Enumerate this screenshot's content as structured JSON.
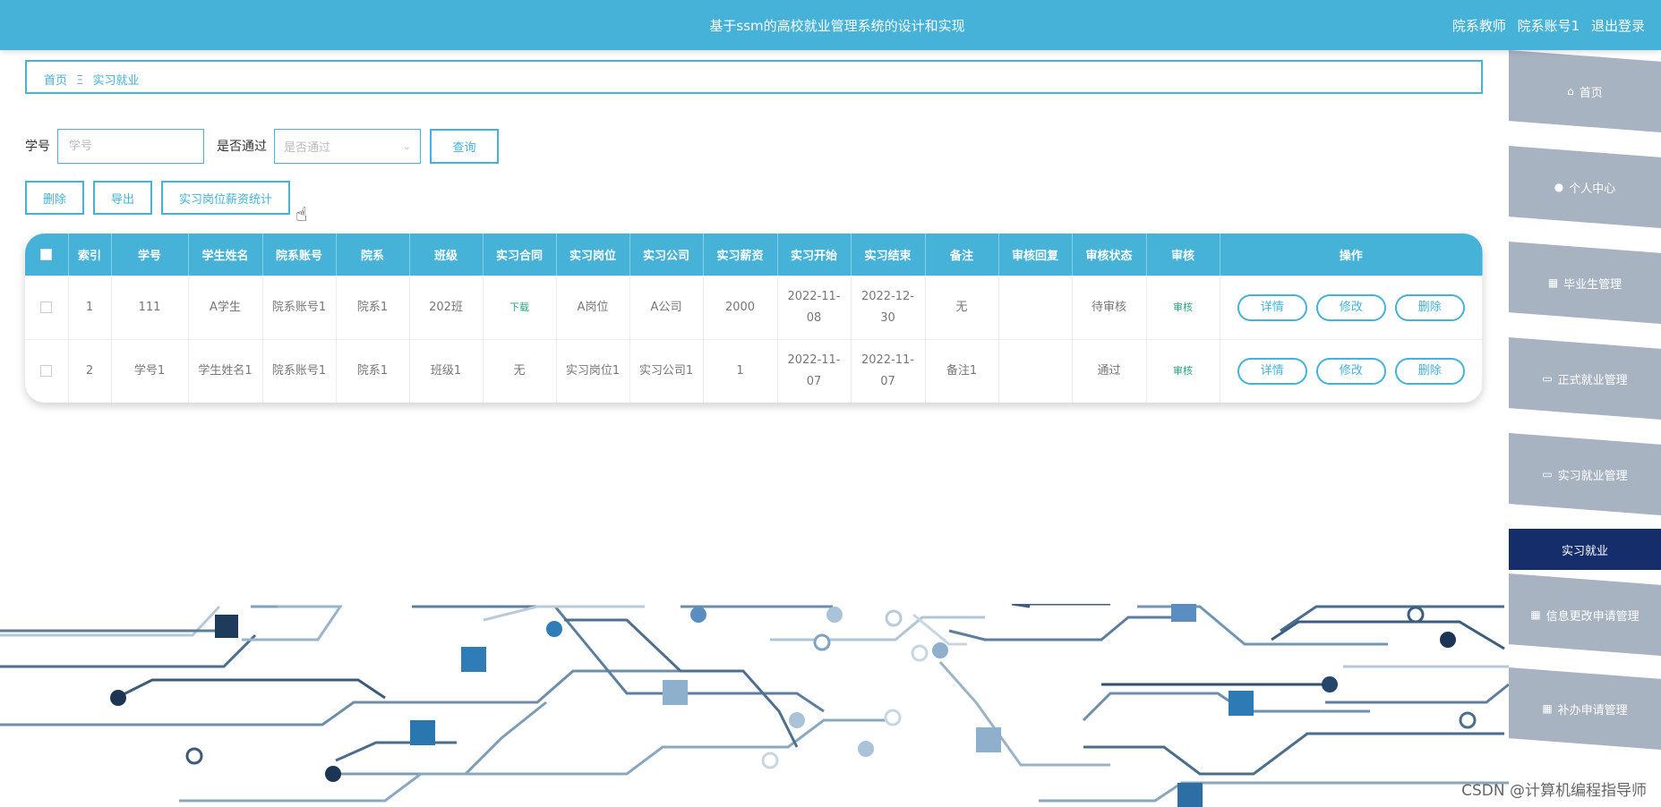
{
  "header": {
    "title": "基于ssm的高校就业管理系统的设计和实现",
    "role": "院系教师",
    "account": "院系账号1",
    "logout": "退出登录"
  },
  "breadcrumb": {
    "home": "首页",
    "separator": "Ξ",
    "current": "实习就业"
  },
  "search": {
    "student_no_label": "学号",
    "student_no_placeholder": "学号",
    "pass_label": "是否通过",
    "pass_placeholder": "是否通过",
    "query_button": "查询"
  },
  "actions": {
    "delete": "删除",
    "export": "导出",
    "stats": "实习岗位薪资统计"
  },
  "table": {
    "headers": [
      "索引",
      "学号",
      "学生姓名",
      "院系账号",
      "院系",
      "班级",
      "实习合同",
      "实习岗位",
      "实习公司",
      "实习薪资",
      "实习开始",
      "实习结束",
      "备注",
      "审核回复",
      "审核状态",
      "审核",
      "操作"
    ],
    "rows": [
      {
        "index": "1",
        "student_no": "111",
        "name": "A学生",
        "dept_account": "院系账号1",
        "dept": "院系1",
        "class": "202班",
        "contract": "下载",
        "position": "A岗位",
        "company": "A公司",
        "salary": "2000",
        "start": "2022-11-08",
        "end": "2022-12-30",
        "note": "无",
        "reply": "",
        "status": "待审核",
        "audit": "审核"
      },
      {
        "index": "2",
        "student_no": "学号1",
        "name": "学生姓名1",
        "dept_account": "院系账号1",
        "dept": "院系1",
        "class": "班级1",
        "contract": "无",
        "position": "实习岗位1",
        "company": "实习公司1",
        "salary": "1",
        "start": "2022-11-07",
        "end": "2022-11-07",
        "note": "备注1",
        "reply": "",
        "status": "通过",
        "audit": "审核"
      }
    ],
    "row_buttons": {
      "detail": "详情",
      "edit": "修改",
      "delete": "删除"
    }
  },
  "sidebar": {
    "items": [
      {
        "label": "首页",
        "icon": "home-icon"
      },
      {
        "label": "个人中心",
        "icon": "user-icon"
      },
      {
        "label": "毕业生管理",
        "icon": "grid-icon"
      },
      {
        "label": "正式就业管理",
        "icon": "monitor-icon"
      },
      {
        "label": "实习就业管理",
        "icon": "monitor-icon"
      },
      {
        "label": "实习就业",
        "active": true
      },
      {
        "label": "信息更改申请管理",
        "icon": "grid-icon"
      },
      {
        "label": "补办申请管理",
        "icon": "grid-icon"
      }
    ]
  },
  "watermark": "CSDN @计算机编程指导师",
  "colors": {
    "primary": "#46b2d8",
    "active_nav": "#152e6b",
    "nav": "#a8b3c2",
    "audit_link": "#2aa57a"
  }
}
